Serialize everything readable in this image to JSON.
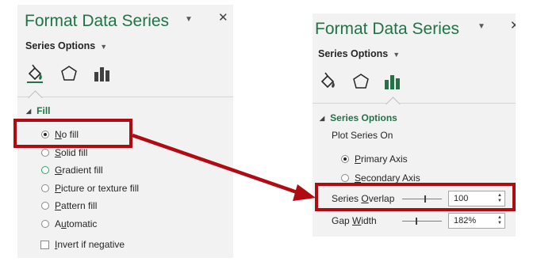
{
  "left_pane": {
    "title": "Format Data Series",
    "header_dropdown": "▼",
    "close_glyph": "✕",
    "series_options_label": "Series Options",
    "series_options_caret": "▼",
    "icons": [
      "fill-line-icon",
      "effects-pentagon-icon",
      "series-options-bar-icon"
    ],
    "active_tab": "fill-line-icon",
    "section": {
      "expand_glyph": "◢",
      "label": "Fill"
    },
    "fill_options": [
      {
        "key": "N",
        "rest": "o fill",
        "selected": true
      },
      {
        "key": "S",
        "rest": "olid fill",
        "selected": false
      },
      {
        "key": "G",
        "rest": "radient fill",
        "selected": false,
        "hover": true
      },
      {
        "key": "P",
        "rest": "icture or texture fill",
        "selected": false
      },
      {
        "key": "P",
        "rest": "attern fill",
        "selected": false
      },
      {
        "key": "",
        "rest": "",
        "full_label": "Automatic",
        "selected": false
      }
    ],
    "automatic_prefix": "A",
    "automatic_key": "u",
    "automatic_rest": "tomatic",
    "invert_prefix": "",
    "invert_key": "I",
    "invert_rest": "nvert if negative",
    "invert_checked": false
  },
  "right_pane": {
    "title": "Format Data Series",
    "header_dropdown": "▼",
    "close_glyph": "✕",
    "series_options_label": "Series Options",
    "series_options_caret": "▼",
    "active_tab": "series-options-bar-icon",
    "section": {
      "expand_glyph": "◢",
      "label": "Series Options"
    },
    "plot_series_on": "Plot Series On",
    "primary_axis": {
      "key": "P",
      "rest": "rimary Axis",
      "selected": true
    },
    "secondary_axis": {
      "key": "S",
      "rest": "econdary Axis",
      "selected": false
    },
    "overlap": {
      "prefix": "Series ",
      "key": "O",
      "rest": "verlap",
      "value": "100",
      "slider_fraction": 1.0
    },
    "gap": {
      "prefix": "Gap ",
      "key": "W",
      "rest": "idth",
      "value": "182%",
      "slider_fraction": 0.36
    }
  },
  "colors": {
    "accent_green": "#217346",
    "highlight_red": "#b00b12",
    "pane_bg": "#f2f2f2"
  }
}
